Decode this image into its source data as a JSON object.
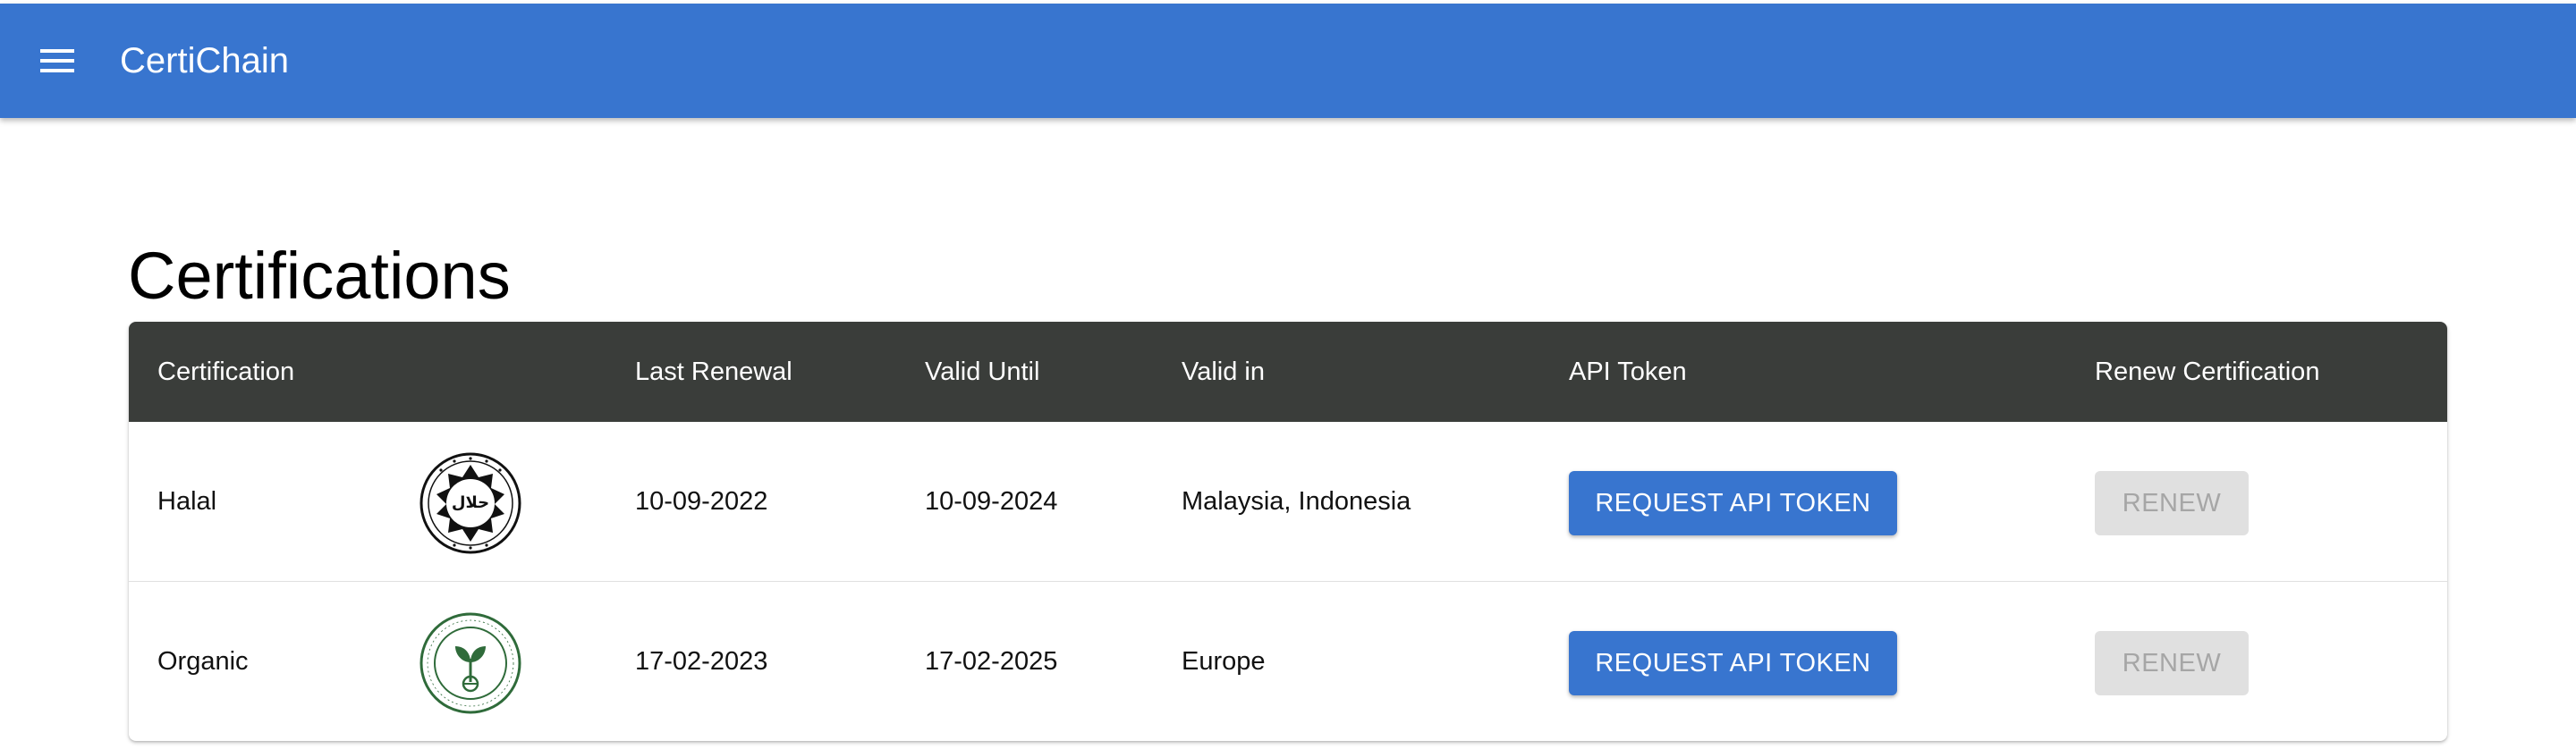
{
  "appbar": {
    "title": "CertiChain",
    "menu_icon": "hamburger-menu-icon"
  },
  "page": {
    "title": "Certifications"
  },
  "table": {
    "headers": [
      "Certification",
      "Last Renewal",
      "Valid Until",
      "Valid in",
      "API Token",
      "Renew Certification"
    ],
    "rows": [
      {
        "certification": "Halal",
        "logo": "halal-logo",
        "logo_text": "حلال",
        "last_renewal": "10-09-2022",
        "valid_until": "10-09-2024",
        "valid_in": "Malaysia, Indonesia",
        "api_button": "REQUEST API TOKEN",
        "renew_button": "RENEW"
      },
      {
        "certification": "Organic",
        "logo": "organic-malaysia-logo",
        "last_renewal": "17-02-2023",
        "valid_until": "17-02-2025",
        "valid_in": "Europe",
        "api_button": "REQUEST API TOKEN",
        "renew_button": "RENEW"
      }
    ]
  },
  "colors": {
    "primary": "#3875cf",
    "table_header": "#3a3d3a",
    "disabled_bg": "#e0e0e0",
    "disabled_text": "#a6a6a6",
    "organic_green": "#2f6b3a"
  }
}
